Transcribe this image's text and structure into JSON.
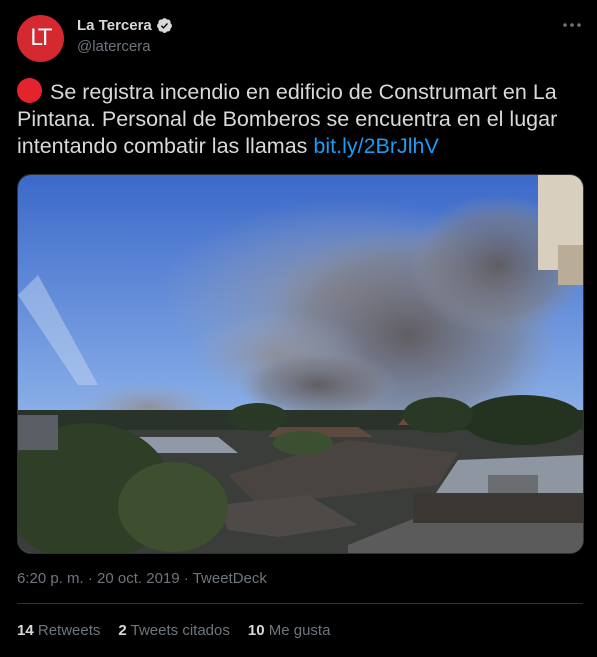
{
  "author": {
    "avatar_text": "LT",
    "display_name": "La Tercera",
    "handle": "@latercera",
    "verified_icon": "verified-badge-icon"
  },
  "tweet": {
    "text": "Se registra incendio en edificio de Construmart en La Pintana. Personal de Bomberos se encuentra en el lugar intentando combatir las llamas",
    "link": "bit.ly/2BrJlhV",
    "emoji_icon": "red-circle-icon"
  },
  "meta": {
    "time": "6:20 p. m.",
    "separator": "·",
    "date": "20 oct. 2019",
    "source": "TweetDeck"
  },
  "stats": {
    "retweets_count": "14",
    "retweets_label": "Retweets",
    "quotes_count": "2",
    "quotes_label": "Tweets citados",
    "likes_count": "10",
    "likes_label": "Me gusta"
  },
  "colors": {
    "background": "#000000",
    "avatar": "#d6282f",
    "link": "#1d9bf0",
    "muted": "#6e767d"
  }
}
